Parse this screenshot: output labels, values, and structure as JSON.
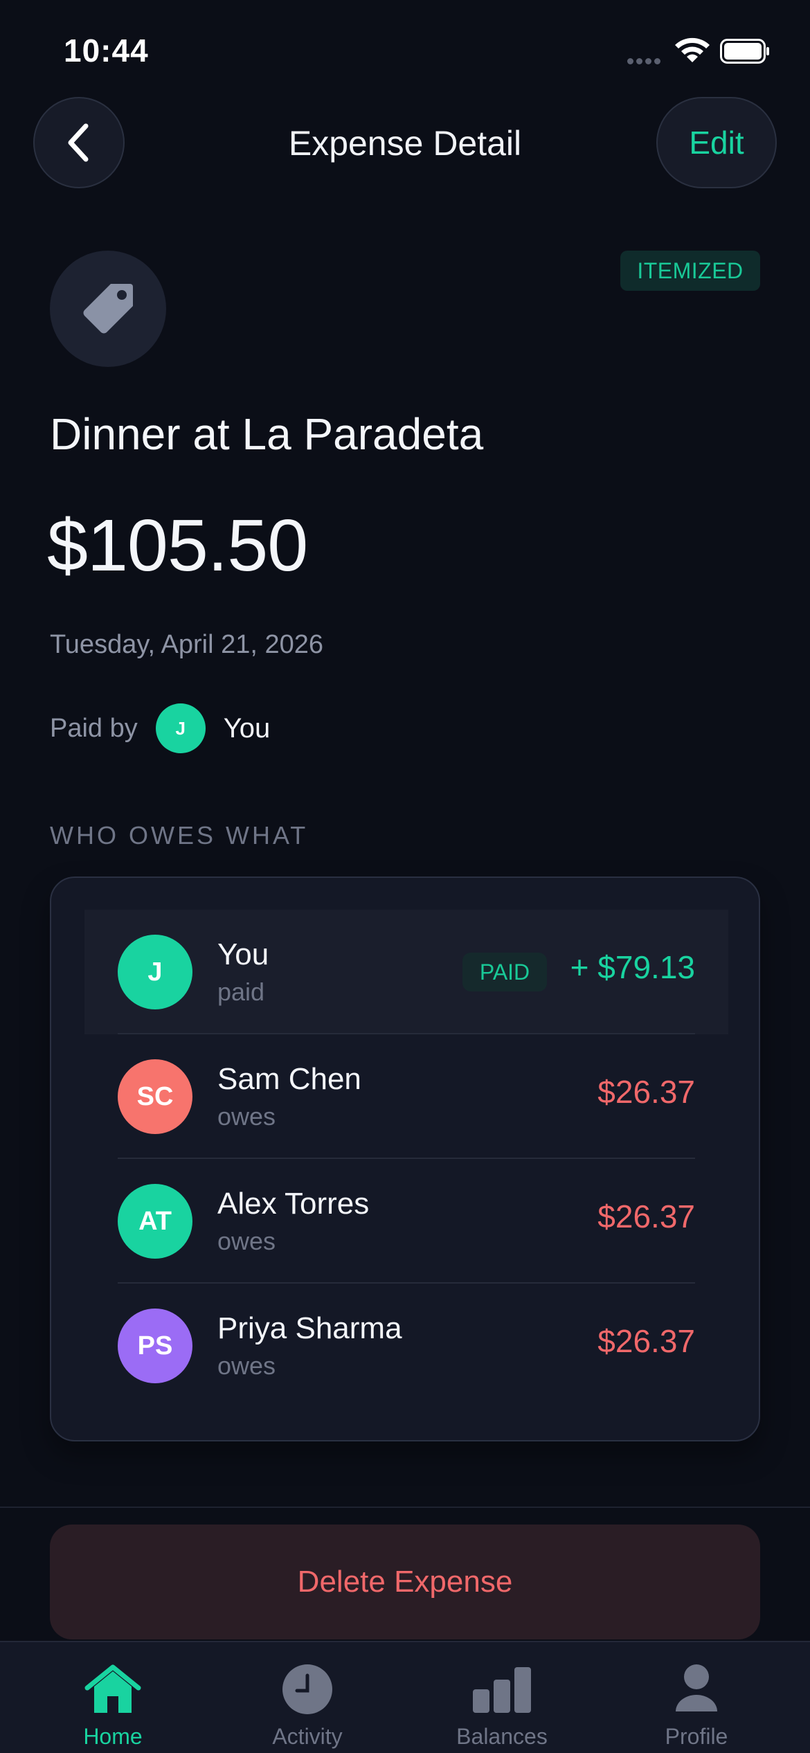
{
  "status_bar": {
    "time": "10:44"
  },
  "header": {
    "title": "Expense Detail",
    "edit_label": "Edit"
  },
  "expense": {
    "category_icon": "tag-icon",
    "badge": "ITEMIZED",
    "title": "Dinner at La Paradeta",
    "amount": "$105.50",
    "date": "Tuesday, April 21, 2026",
    "paid_by_label": "Paid by",
    "payer_initial": "J",
    "payer_name": "You"
  },
  "section_label": "WHO OWES WHAT",
  "participants": [
    {
      "initials": "J",
      "name": "You",
      "status": "paid",
      "badge": "PAID",
      "amount": "+ $79.13",
      "color": "#19d3a0"
    },
    {
      "initials": "SC",
      "name": "Sam Chen",
      "status": "owes",
      "amount": "$26.37",
      "color": "#f7746d"
    },
    {
      "initials": "AT",
      "name": "Alex Torres",
      "status": "owes",
      "amount": "$26.37",
      "color": "#19d3a0"
    },
    {
      "initials": "PS",
      "name": "Priya Sharma",
      "status": "owes",
      "amount": "$26.37",
      "color": "#9b6cf5"
    }
  ],
  "delete_label": "Delete Expense",
  "tabs": [
    {
      "label": "Home",
      "icon": "home-icon",
      "active": true
    },
    {
      "label": "Activity",
      "icon": "clock-icon",
      "active": false
    },
    {
      "label": "Balances",
      "icon": "bar-chart-icon",
      "active": false
    },
    {
      "label": "Profile",
      "icon": "person-icon",
      "active": false
    }
  ],
  "colors": {
    "accent": "#19d3a0",
    "danger": "#f0686a",
    "background": "#0b0e17"
  }
}
